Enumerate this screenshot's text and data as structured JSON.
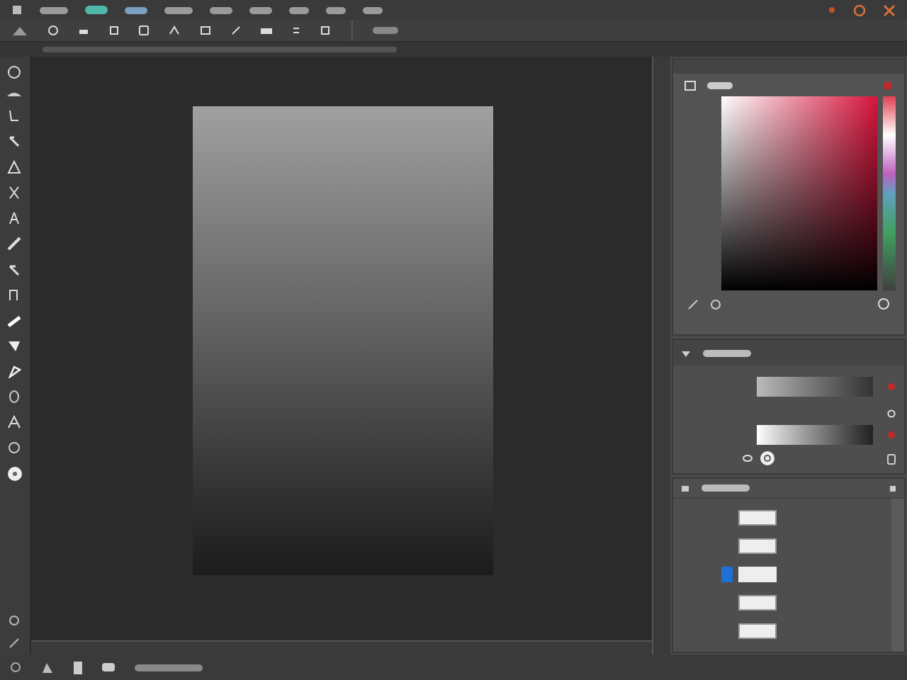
{
  "layers": [
    {
      "selected": false
    },
    {
      "selected": false
    },
    {
      "selected": true
    },
    {
      "selected": false
    },
    {
      "selected": false
    }
  ]
}
